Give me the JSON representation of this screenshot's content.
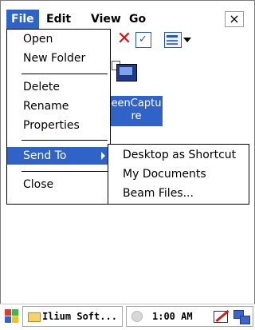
{
  "menubar": {
    "items": [
      {
        "label": "File",
        "active": true
      },
      {
        "label": "Edit",
        "active": false
      },
      {
        "label": "View",
        "active": false
      },
      {
        "label": "Go",
        "active": false
      }
    ],
    "close_label": "×"
  },
  "file_view": {
    "selected_file_label_line1": "eenCaptu",
    "selected_file_label_line2": "re"
  },
  "file_menu": {
    "items": [
      {
        "label": "Open"
      },
      {
        "label": "New Folder"
      },
      {
        "label": "Delete"
      },
      {
        "label": "Rename"
      },
      {
        "label": "Properties"
      },
      {
        "label": "Send To",
        "highlighted": true,
        "has_submenu": true
      },
      {
        "label": "Close"
      }
    ]
  },
  "send_to_menu": {
    "items": [
      {
        "label": "Desktop as Shortcut"
      },
      {
        "label": "My Documents"
      },
      {
        "label": "Beam Files..."
      }
    ]
  },
  "taskbar": {
    "task_label": "Ilium Soft...",
    "clock": "1:00 AM"
  },
  "colors": {
    "highlight": "#2f63c7",
    "window_bg": "#ffffff"
  }
}
